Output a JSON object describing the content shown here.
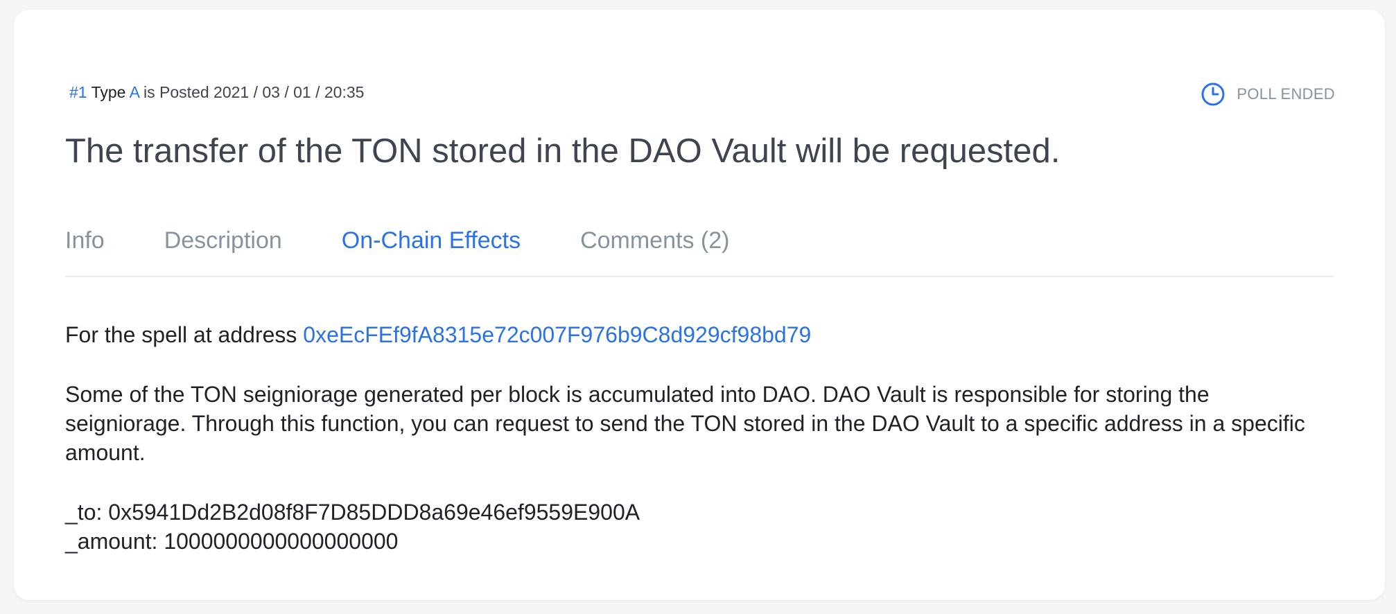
{
  "colors": {
    "accent": "#2a72e5",
    "muted": "#86929d",
    "text": "#1e2127",
    "title": "#3e4450",
    "background": "#f4f5f7",
    "card": "#ffffff",
    "divider": "#e7ebf2"
  },
  "agenda": {
    "number": "#1",
    "type_label": "Type",
    "type_value": "A",
    "posted_label": "is Posted",
    "posted_date": "2021 / 03 / 01 / 20:35",
    "status_icon": "clock-icon",
    "status": "POLL ENDED",
    "title": "The transfer of the TON stored in the DAO Vault will be requested."
  },
  "tabs": [
    {
      "label": "Info",
      "active": false
    },
    {
      "label": "Description",
      "active": false
    },
    {
      "label": "On-Chain Effects",
      "active": true
    },
    {
      "label": "Comments (2)",
      "active": false
    }
  ],
  "effects": {
    "spell_prefix": "For the spell at address",
    "spell_address": "0xeEcFEf9fA8315e72c007F976b9C8d929cf98bd79",
    "description": "Some of the TON seigniorage generated per block is accumulated into DAO. DAO Vault is responsible for storing the seigniorage. Through this function, you can request to send the TON stored in the DAO Vault to a specific address in a specific amount.",
    "params": [
      {
        "name": "_to",
        "value": "0x5941Dd2B2d08f8F7D85DDD8a69e46ef9559E900A"
      },
      {
        "name": "_amount",
        "value": "1000000000000000000"
      }
    ]
  }
}
